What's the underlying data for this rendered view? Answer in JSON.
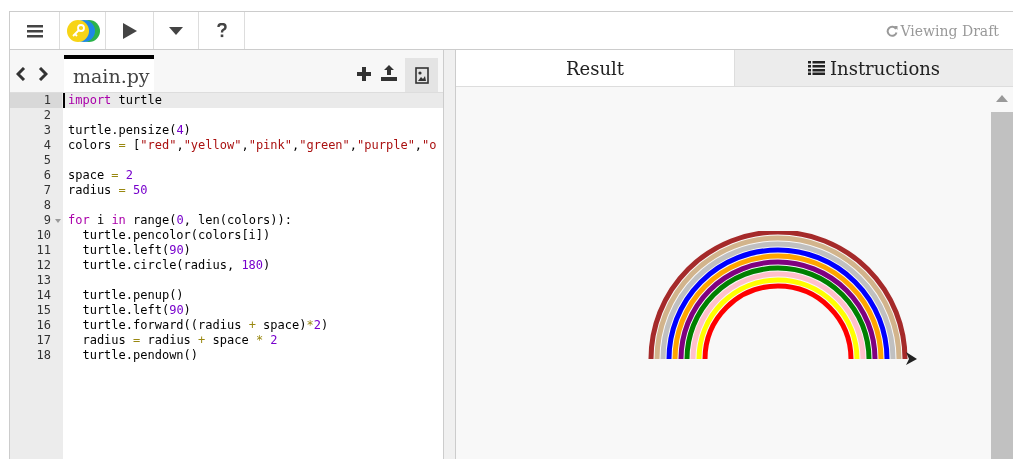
{
  "toolbar": {
    "status": "Viewing Draft"
  },
  "file_tabs": [
    {
      "label": "main.py",
      "selected": true
    }
  ],
  "code": [
    {
      "number": "1",
      "tokens": [
        {
          "text": "import",
          "kind": "keyword"
        },
        {
          "text": " turtle",
          "kind": "plain"
        }
      ]
    },
    {
      "number": "2"
    },
    {
      "number": "3",
      "tokens": [
        {
          "text": "turtle.pensize(",
          "kind": "plain"
        },
        {
          "text": "4",
          "kind": "number"
        },
        {
          "text": ")",
          "kind": "plain"
        }
      ]
    },
    {
      "number": "4",
      "tokens": [
        {
          "text": "colors ",
          "kind": "plain"
        },
        {
          "text": "=",
          "kind": "operator"
        },
        {
          "text": " [",
          "kind": "plain"
        },
        {
          "text": "\"red\"",
          "kind": "string"
        },
        {
          "text": ",",
          "kind": "plain"
        },
        {
          "text": "\"yellow\"",
          "kind": "string"
        },
        {
          "text": ",",
          "kind": "plain"
        },
        {
          "text": "\"pink\"",
          "kind": "string"
        },
        {
          "text": ",",
          "kind": "plain"
        },
        {
          "text": "\"green\"",
          "kind": "string"
        },
        {
          "text": ",",
          "kind": "plain"
        },
        {
          "text": "\"purple\"",
          "kind": "string"
        },
        {
          "text": ",",
          "kind": "plain"
        },
        {
          "text": "\"o",
          "kind": "string"
        }
      ]
    },
    {
      "number": "5"
    },
    {
      "number": "6",
      "tokens": [
        {
          "text": "space ",
          "kind": "plain"
        },
        {
          "text": "=",
          "kind": "operator"
        },
        {
          "text": " 2",
          "kind": "number"
        }
      ]
    },
    {
      "number": "7",
      "tokens": [
        {
          "text": "radius ",
          "kind": "plain"
        },
        {
          "text": "=",
          "kind": "operator"
        },
        {
          "text": " 50",
          "kind": "number"
        }
      ]
    },
    {
      "number": "8"
    },
    {
      "number": "9",
      "tokens": [
        {
          "text": "for",
          "kind": "keyword"
        },
        {
          "text": " i ",
          "kind": "plain"
        },
        {
          "text": "in",
          "kind": "keyword"
        },
        {
          "text": " range(",
          "kind": "plain"
        },
        {
          "text": "0",
          "kind": "number"
        },
        {
          "text": ", len(colors)):",
          "kind": "plain"
        }
      ]
    },
    {
      "number": "10",
      "tokens": [
        {
          "text": "  turtle.pencolor(colors[i])",
          "kind": "plain"
        }
      ]
    },
    {
      "number": "11",
      "tokens": [
        {
          "text": "  turtle.left(",
          "kind": "plain"
        },
        {
          "text": "90",
          "kind": "number"
        },
        {
          "text": ")",
          "kind": "plain"
        }
      ]
    },
    {
      "number": "12",
      "tokens": [
        {
          "text": "  turtle.circle(radius, ",
          "kind": "plain"
        },
        {
          "text": "180",
          "kind": "number"
        },
        {
          "text": ")",
          "kind": "plain"
        }
      ]
    },
    {
      "number": "13"
    },
    {
      "number": "14",
      "tokens": [
        {
          "text": "  turtle.penup()",
          "kind": "plain"
        }
      ]
    },
    {
      "number": "15",
      "tokens": [
        {
          "text": "  turtle.left(",
          "kind": "plain"
        },
        {
          "text": "90",
          "kind": "number"
        },
        {
          "text": ")",
          "kind": "plain"
        }
      ]
    },
    {
      "number": "16",
      "tokens": [
        {
          "text": "  turtle.forward((radius ",
          "kind": "plain"
        },
        {
          "text": "+",
          "kind": "operator"
        },
        {
          "text": " space)",
          "kind": "plain"
        },
        {
          "text": "*",
          "kind": "operator"
        },
        {
          "text": "2",
          "kind": "number"
        },
        {
          "text": ")",
          "kind": "plain"
        }
      ]
    },
    {
      "number": "17",
      "tokens": [
        {
          "text": "  radius ",
          "kind": "plain"
        },
        {
          "text": "=",
          "kind": "operator"
        },
        {
          "text": " radius ",
          "kind": "plain"
        },
        {
          "text": "+",
          "kind": "operator"
        },
        {
          "text": " space ",
          "kind": "plain"
        },
        {
          "text": "*",
          "kind": "operator"
        },
        {
          "text": " 2",
          "kind": "number"
        }
      ]
    },
    {
      "number": "18",
      "tokens": [
        {
          "text": "  turtle.pendown()",
          "kind": "plain"
        }
      ]
    }
  ],
  "output_tabs": [
    {
      "label": "Result",
      "selected": true
    },
    {
      "label": "Instructions",
      "selected": false
    }
  ]
}
